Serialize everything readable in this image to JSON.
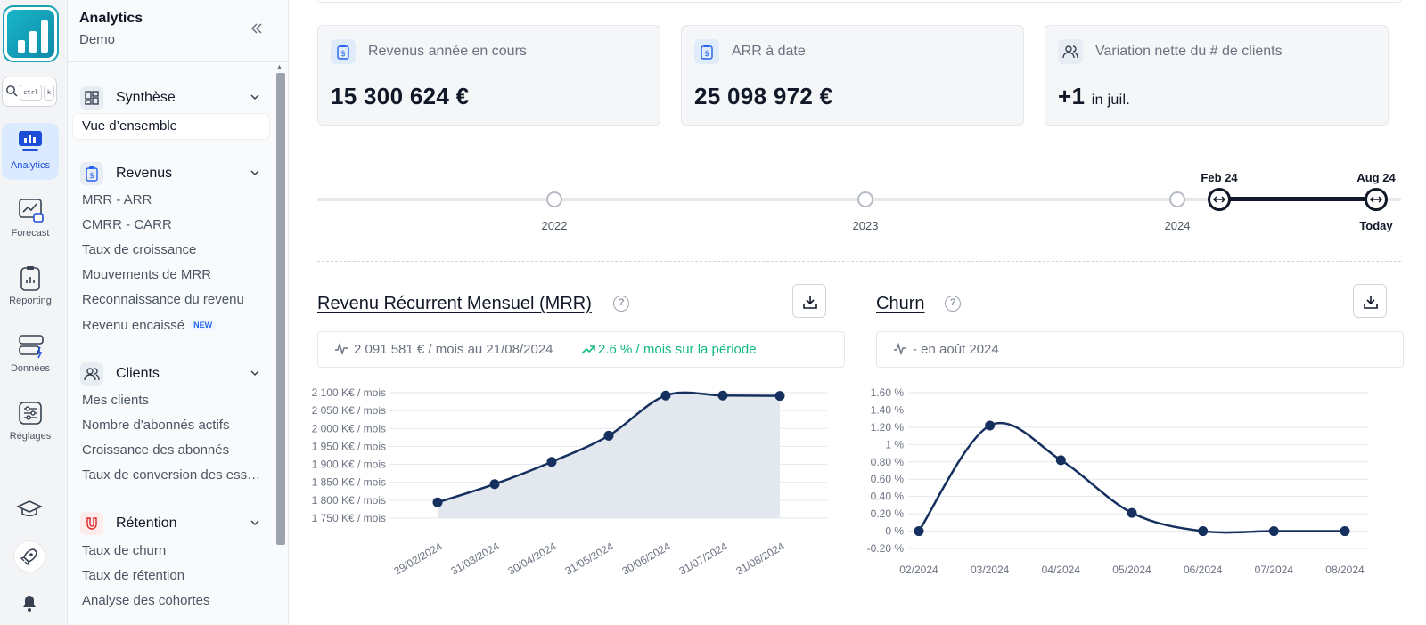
{
  "app": {
    "title": "Analytics",
    "subtitle": "Demo"
  },
  "rail": {
    "search_keys": [
      "ctrl",
      "k"
    ],
    "items": [
      {
        "label": "Analytics",
        "icon": "analytics-icon",
        "active": true
      },
      {
        "label": "Forecast",
        "icon": "forecast-icon"
      },
      {
        "label": "Reporting",
        "icon": "reporting-icon"
      },
      {
        "label": "Données",
        "icon": "data-icon"
      },
      {
        "label": "Réglages",
        "icon": "settings-icon"
      }
    ],
    "bottom_icons": [
      "graduation-cap-icon",
      "rocket-icon",
      "bell-icon"
    ]
  },
  "nav": {
    "sections": [
      {
        "title": "Synthèse",
        "icon": "dashboard-icon",
        "items": [
          "Vue d’ensemble"
        ],
        "active_item": "Vue d’ensemble"
      },
      {
        "title": "Revenus",
        "icon": "revenue-icon",
        "items": [
          "MRR - ARR",
          "CMRR - CARR",
          "Taux de croissance",
          "Mouvements de MRR",
          "Reconnaissance du revenu",
          "Revenu encaissé"
        ],
        "badge": "NEW"
      },
      {
        "title": "Clients",
        "icon": "clients-icon",
        "items": [
          "Mes clients",
          "Nombre d'abonnés actifs",
          "Croissance des abonnés",
          "Taux de conversion des ess…"
        ]
      },
      {
        "title": "Rétention",
        "icon": "magnet-icon",
        "items": [
          "Taux de churn",
          "Taux de rétention",
          "Analyse des cohortes"
        ]
      }
    ]
  },
  "kpis": [
    {
      "label": "Revenus année en cours",
      "value": "15 300 624 €",
      "icon": "revenue-icon"
    },
    {
      "label": "ARR à date",
      "value": "25 098 972 €",
      "icon": "revenue-icon"
    },
    {
      "label": "Variation nette du # de clients",
      "value": "+1",
      "suffix": "in juil.",
      "icon": "clients-icon"
    }
  ],
  "timeline": {
    "years": [
      "2022",
      "2023",
      "2024"
    ],
    "range_start": "Feb 24",
    "range_end": "Aug 24",
    "end_label": "Today"
  },
  "mrr": {
    "title": "Revenu Récurrent Mensuel (MRR)",
    "info": "2 091 581 € / mois au 21/08/2024",
    "growth": "2.6 % / mois sur la période"
  },
  "churn": {
    "title": "Churn",
    "info": "- en août 2024"
  },
  "chart_data": [
    {
      "type": "area",
      "title": "Revenu Récurrent Mensuel (MRR)",
      "x": [
        "29/02/2024",
        "31/03/2024",
        "30/04/2024",
        "31/05/2024",
        "30/06/2024",
        "31/07/2024",
        "31/08/2024"
      ],
      "y_ticks": [
        "2 100 K€ / mois",
        "2 050 K€ / mois",
        "2 000 K€ / mois",
        "1 950 K€ / mois",
        "1 900 K€ / mois",
        "1 850 K€ / mois",
        "1 800 K€ / mois",
        "1 750 K€ / mois"
      ],
      "values": [
        1794,
        1845,
        1907,
        1980,
        2092,
        2092,
        2091
      ],
      "ylim": [
        1750,
        2100
      ],
      "color": "#15305f",
      "fill": "#e3e7ee"
    },
    {
      "type": "line",
      "title": "Churn",
      "x": [
        "02/2024",
        "03/2024",
        "04/2024",
        "05/2024",
        "06/2024",
        "07/2024",
        "08/2024"
      ],
      "y_ticks": [
        "1.60 %",
        "1.40 %",
        "1.20 %",
        "1 %",
        "0.80 %",
        "0.60 %",
        "0.40 %",
        "0.20 %",
        "0 %",
        "-0.20 %"
      ],
      "values": [
        0,
        1.22,
        0.82,
        0.21,
        0,
        0,
        0
      ],
      "ylim": [
        -0.2,
        1.6
      ],
      "color": "#15305f"
    }
  ]
}
